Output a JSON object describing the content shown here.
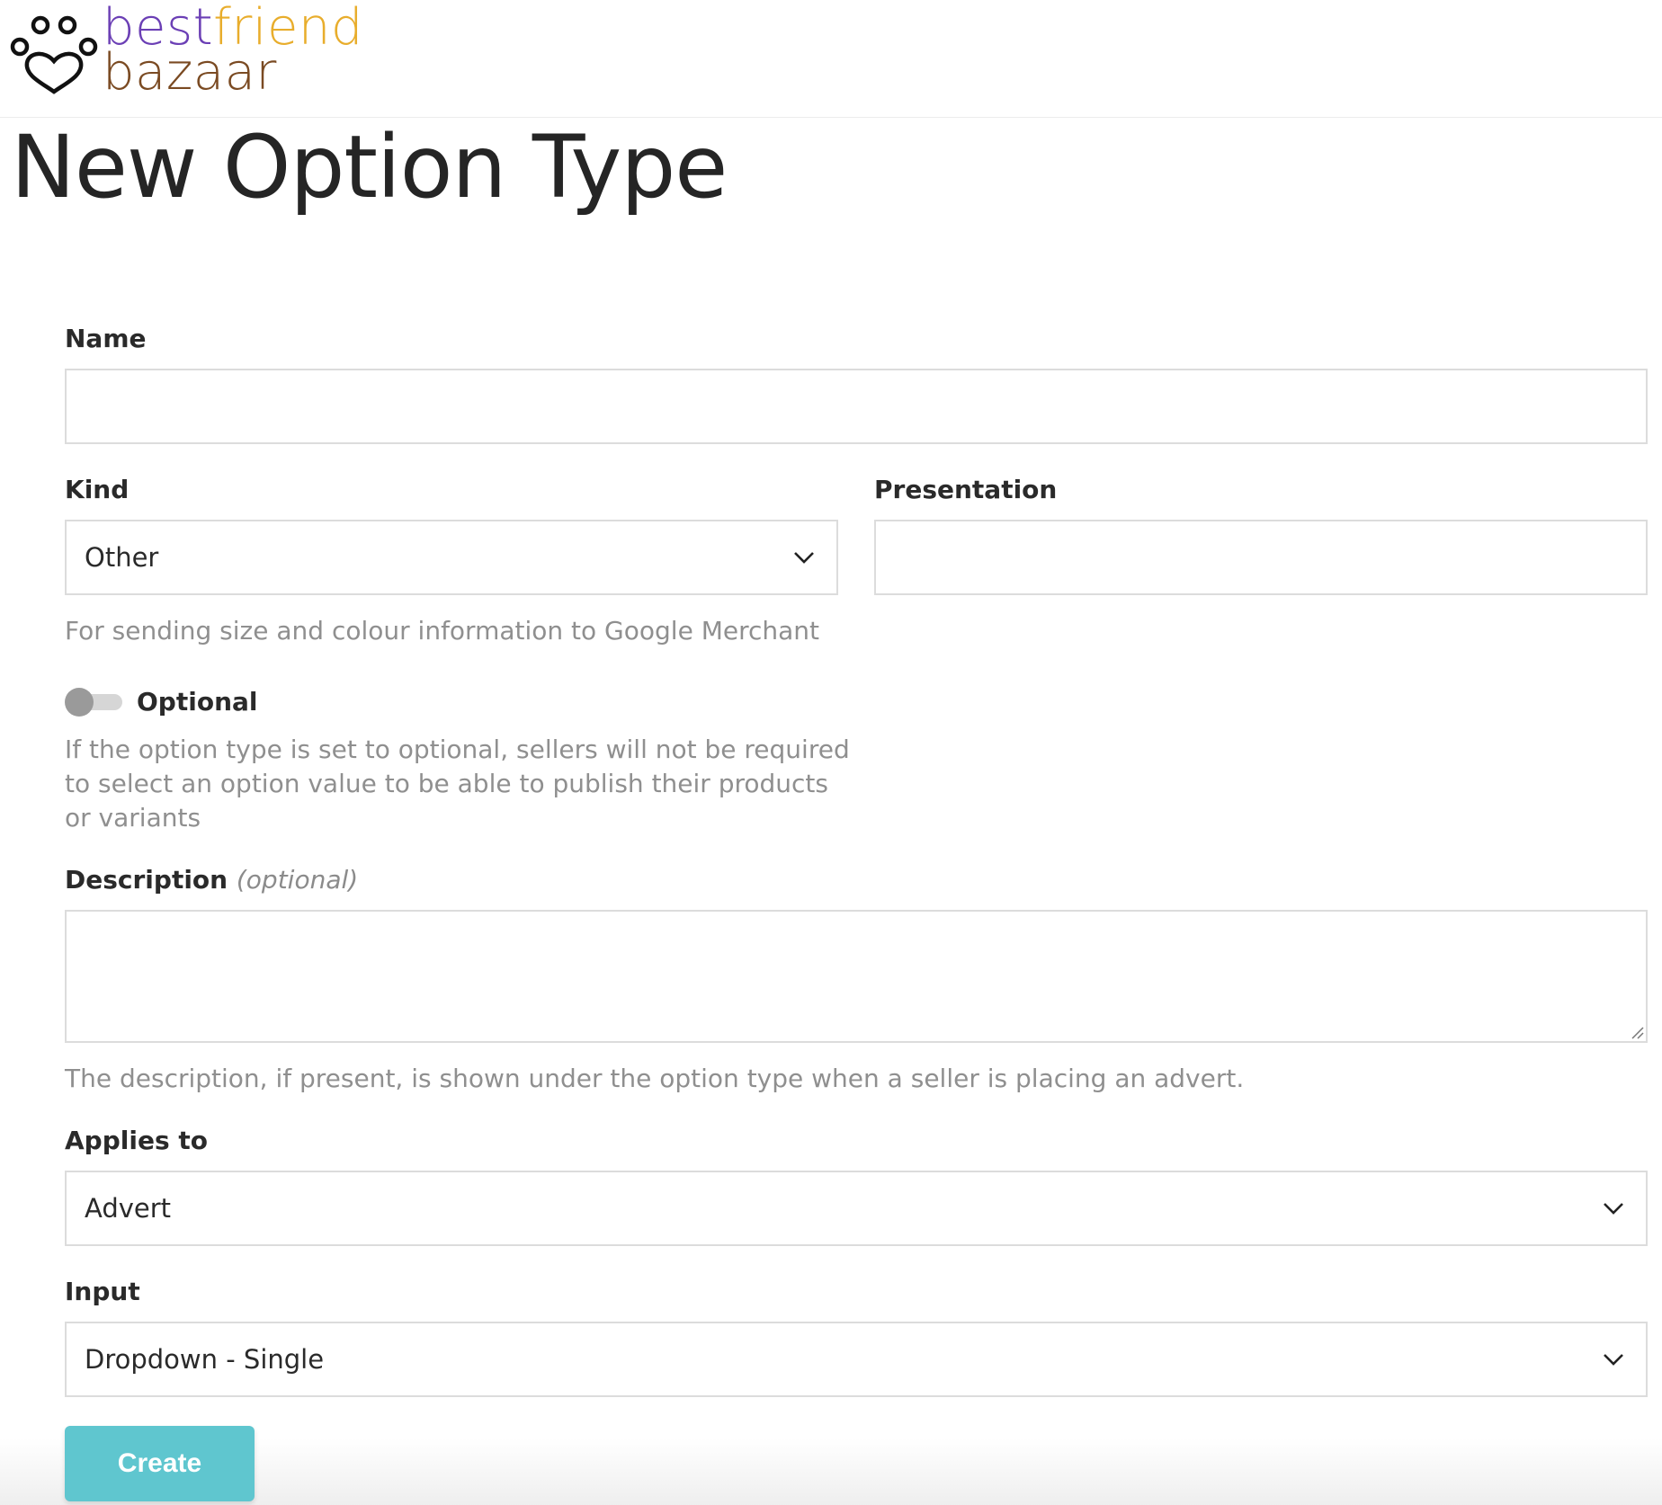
{
  "brand": {
    "line1_part1": "best",
    "line1_part2": "friend",
    "line2": "bazaar",
    "colors": {
      "purple": "#6b3fb5",
      "gold": "#e8ad2c",
      "brown": "#7a4a22"
    },
    "icon": "paw-icon"
  },
  "page": {
    "title": "New Option Type"
  },
  "form": {
    "name": {
      "label": "Name",
      "value": ""
    },
    "kind": {
      "label": "Kind",
      "selected": "Other",
      "help": "For sending size and colour information to Google Merchant",
      "icon": "chevron-down-icon"
    },
    "presentation": {
      "label": "Presentation",
      "value": ""
    },
    "optional": {
      "label": "Optional",
      "checked": false,
      "help": "If the option type is set to optional, sellers will not be required to select an option value to be able to publish their products or variants"
    },
    "description": {
      "label": "Description",
      "optional_note": "(optional)",
      "value": "",
      "help": "The description, if present, is shown under the option type when a seller is placing an advert."
    },
    "applies_to": {
      "label": "Applies to",
      "selected": "Advert",
      "icon": "chevron-down-icon"
    },
    "input": {
      "label": "Input",
      "selected": "Dropdown - Single",
      "icon": "chevron-down-icon"
    },
    "submit": {
      "label": "Create",
      "color": "#5fc6cf"
    }
  }
}
